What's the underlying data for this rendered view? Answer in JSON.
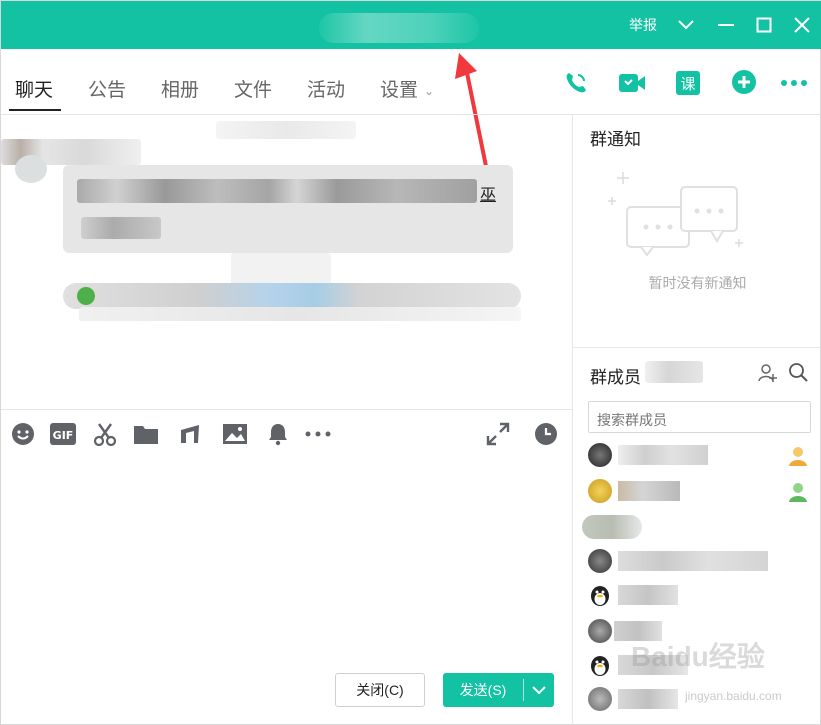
{
  "titlebar": {
    "report_label": "举报",
    "colors": {
      "accent": "#12c2a3"
    }
  },
  "tabs": [
    {
      "label": "聊天",
      "active": true
    },
    {
      "label": "公告"
    },
    {
      "label": "相册"
    },
    {
      "label": "文件"
    },
    {
      "label": "活动"
    },
    {
      "label": "设置"
    }
  ],
  "toolbar_icons": [
    "phone-icon",
    "video-icon",
    "class-icon",
    "add-app-icon",
    "more-icon"
  ],
  "chat": {
    "message_tail": "巫"
  },
  "input_toolbar_icons": [
    "emoji-icon",
    "gif-icon",
    "scissors-icon",
    "folder-icon",
    "music-icon",
    "image-icon",
    "bell-icon",
    "more-icon",
    "expand-icon",
    "history-icon"
  ],
  "buttons": {
    "close_label": "关闭(C)",
    "send_label": "发送(S)"
  },
  "group_notice": {
    "title": "群通知",
    "empty_text": "暂时没有新通知"
  },
  "members": {
    "title": "群成员",
    "search_placeholder": "搜索群成员"
  },
  "watermark": {
    "text": "Baidu经验",
    "sub": "jingyan.baidu.com"
  }
}
